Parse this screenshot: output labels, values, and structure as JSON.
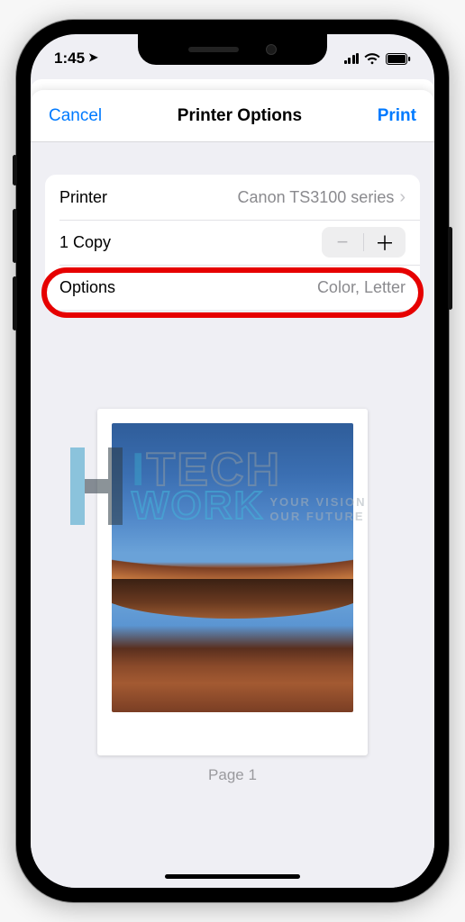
{
  "status": {
    "time": "1:45",
    "location_icon": "location-arrow"
  },
  "nav": {
    "cancel": "Cancel",
    "title": "Printer Options",
    "print": "Print"
  },
  "settings": {
    "printer_label": "Printer",
    "printer_value": "Canon TS3100 series",
    "copies_label": "1 Copy",
    "options_label": "Options",
    "options_value": "Color, Letter"
  },
  "preview": {
    "caption": "Page 1"
  },
  "watermark": {
    "brand_top_pre": "I",
    "brand_top_rest": "TECH",
    "brand_bottom": "WORK",
    "tag1": "YOUR VISION",
    "tag2": "OUR FUTURE"
  }
}
